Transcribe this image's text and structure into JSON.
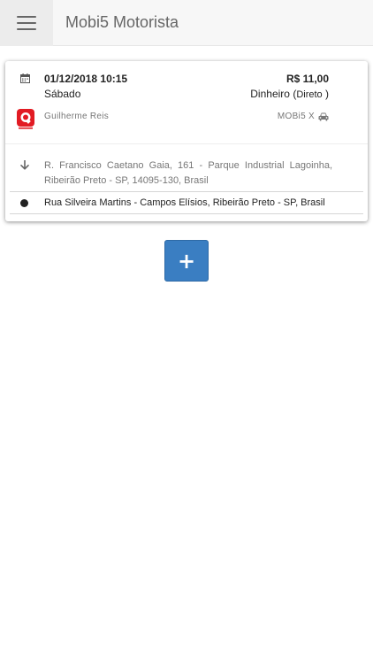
{
  "header": {
    "title": "Mobi5 Motorista",
    "menu_icon": "hamburger-menu-icon"
  },
  "ride": {
    "date": "01/12/2018 10:15",
    "weekday": "Sábado",
    "price": "R$ 11,00",
    "payment_method": "Dinheiro",
    "payment_type": "Direto",
    "driver_name": "Guilherme Reis",
    "service": "MOBi5 X",
    "origin": "R. Francisco Caetano Gaia, 161 - Parque Industrial Lagoinha, Ribeirão Preto - SP, 14095-130, Brasil",
    "destination": "Rua Silveira Martins - Campos Elísios, Ribeirão Preto - SP, Brasil",
    "logo_color": "#e21b23"
  },
  "actions": {
    "add_label": "+",
    "add_color": "#3a7ec2"
  }
}
